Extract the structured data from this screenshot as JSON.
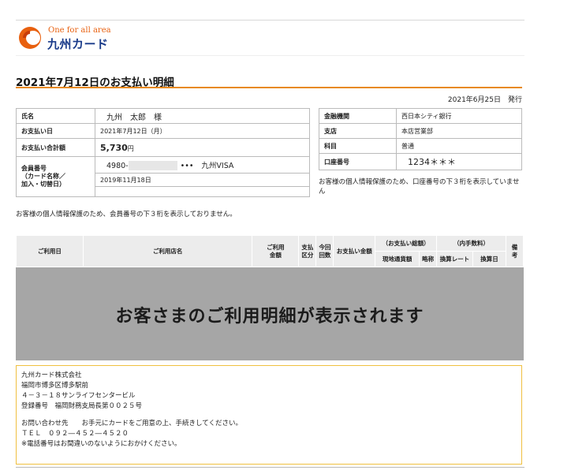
{
  "logo": {
    "tagline": "One for all area",
    "name": "九州カード",
    "accent_color": "#e8600f",
    "brand_color": "#1a3b8a"
  },
  "page_title": "2021年7月12日のお支払い明細",
  "issue_date": "2021年6月25日　発行",
  "member_info": {
    "name_label": "氏名",
    "name_value": "九州　太郎　様",
    "pay_date_label": "お支払い日",
    "pay_date_value": "2021年7月12日（月）",
    "total_label": "お支払い合計額",
    "total_value": "5,730",
    "total_unit": "円",
    "member_no_label_1": "会員番号",
    "member_no_label_2": "（カード名称／",
    "member_no_label_3": "加入・切替日）",
    "member_no_prefix": "4980-",
    "member_no_mask": "•••",
    "card_name": "九州VISA",
    "join_date": "2019年11月18日"
  },
  "member_note": "お客様の個人情報保護のため、会員番号の下３桁を表示しておりません。",
  "bank_info": {
    "bank_label": "金融機関",
    "bank_value": "西日本シティ銀行",
    "branch_label": "支店",
    "branch_value": "本店営業部",
    "type_label": "科目",
    "type_value": "普通",
    "account_label": "口座番号",
    "account_value": "1234＊＊＊"
  },
  "bank_note": "お客様の個人情報保護のため、口座番号の下３桁を表示していません",
  "usage_header": {
    "date": "ご利用日",
    "shop": "ご利用店名",
    "amount_1": "ご利用",
    "amount_2": "金額",
    "type_1": "支払",
    "type_2": "区分",
    "times_1": "今回",
    "times_2": "回数",
    "payment": "お支払い金額",
    "pay_total": "（お支払い総額）",
    "fee": "（内手数料）",
    "local_amount": "現地通貨額",
    "abbr": "略称",
    "rate": "換算レート",
    "rate_date": "換算日",
    "remarks_1": "備",
    "remarks_2": "考"
  },
  "placeholder_message": "お客さまのご利用明細が表示されます",
  "footer": {
    "company": "九州カード株式会社",
    "address_1": "福岡市博多区博多駅前",
    "address_2": "４－３－１８サンライフセンタービル",
    "registration": "登録番号　福岡財務支局長第００２５号",
    "contact": "お問い合わせ先　　お手元にカードをご用意の上、手続きしてください。",
    "tel": "ＴＥＬ　０９２―４５２―４５２０",
    "tel_note": "※電話番号はお間違いのないようにおかけください。"
  }
}
